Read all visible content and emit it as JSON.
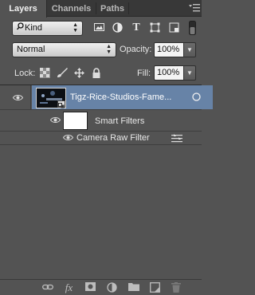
{
  "tabs": [
    {
      "label": "Layers",
      "active": true
    },
    {
      "label": "Channels",
      "active": false
    },
    {
      "label": "Paths",
      "active": false
    }
  ],
  "filter": {
    "kind_label": "Kind",
    "icons": [
      "image-filter-icon",
      "adjustment-filter-icon",
      "type-filter-icon",
      "shape-filter-icon",
      "smart-object-filter-icon",
      "filter-toggle-icon"
    ]
  },
  "blend": {
    "mode": "Normal",
    "opacity_label": "Opacity:",
    "opacity_value": "100%"
  },
  "lock": {
    "label": "Lock:",
    "fill_label": "Fill:",
    "fill_value": "100%"
  },
  "layers": {
    "main_layer_name": "Tigz-Rice-Studios-Fame...",
    "smart_filters_label": "Smart Filters",
    "camera_raw_label": "Camera Raw Filter"
  },
  "colors": {
    "selected_row": "#6783a7",
    "panel_bg": "#535353"
  }
}
